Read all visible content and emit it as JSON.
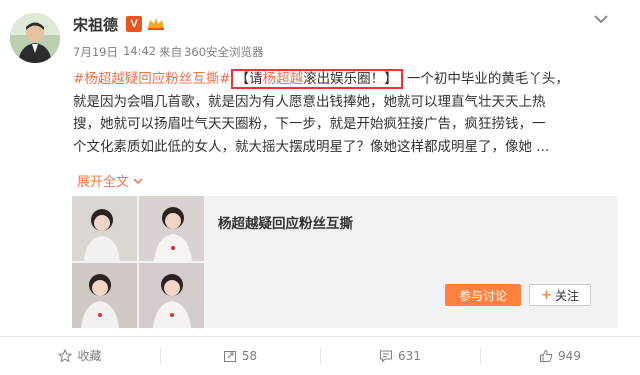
{
  "user": {
    "name": "宋祖德"
  },
  "meta": {
    "date": "7月19日",
    "time": "14:42",
    "from": "来自",
    "source": "360安全浏览器"
  },
  "post": {
    "hashtag": "#杨超越疑回应粉丝互撕#",
    "quote_open": "【请",
    "quote_name": "杨超越",
    "quote_rest": "滚出娱乐圈！】",
    "line1_rest": "一个初中毕业的黄毛丫头，",
    "line2": "就是因为会唱几首歌，就是因为有人愿意出钱捧她，她就可以理直气壮天天上热",
    "line3": "搜，她就可以扬眉吐气天天圈粉，下一步，就是开始疯狂接广告，疯狂捞钱，一",
    "line4": "个文化素质如此低的女人，就大摇大摆成明星了？像她这样都成明星了，像她 ...",
    "expand": "展开全文"
  },
  "card": {
    "title": "杨超越疑回应粉丝互撕",
    "join": "参与讨论",
    "follow": "关注"
  },
  "footer": {
    "favorite": "收藏",
    "repost": "58",
    "comment": "631",
    "like": "949"
  },
  "colors": {
    "accent": "#eb7350",
    "button": "#ff8140",
    "v_badge": "#e8551f",
    "highlight_border": "#ee3333"
  }
}
